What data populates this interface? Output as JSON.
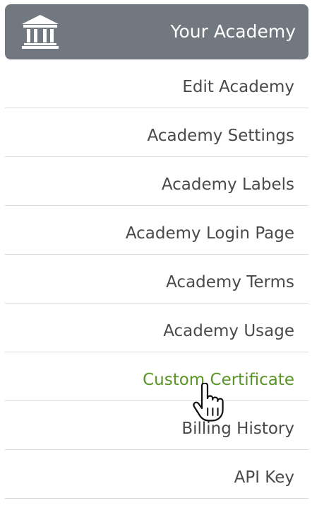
{
  "header": {
    "title": "Your Academy",
    "icon": "bank-icon",
    "background": "#727880"
  },
  "menu": {
    "items": [
      {
        "name": "menu-item-edit-academy",
        "label": "Edit Academy",
        "active": false
      },
      {
        "name": "menu-item-academy-settings",
        "label": "Academy Settings",
        "active": false
      },
      {
        "name": "menu-item-academy-labels",
        "label": "Academy Labels",
        "active": false
      },
      {
        "name": "menu-item-academy-login-page",
        "label": "Academy Login Page",
        "active": false
      },
      {
        "name": "menu-item-academy-terms",
        "label": "Academy Terms",
        "active": false
      },
      {
        "name": "menu-item-academy-usage",
        "label": "Academy Usage",
        "active": false
      },
      {
        "name": "menu-item-custom-certificate",
        "label": "Custom Certificate",
        "active": true
      },
      {
        "name": "menu-item-billing-history",
        "label": "Billing History",
        "active": false
      },
      {
        "name": "menu-item-api-key",
        "label": "API Key",
        "active": false
      }
    ],
    "text_color": "#4a4a4a",
    "active_color": "#5a9426"
  },
  "cursor": {
    "icon": "hand-pointer-cursor-icon"
  }
}
